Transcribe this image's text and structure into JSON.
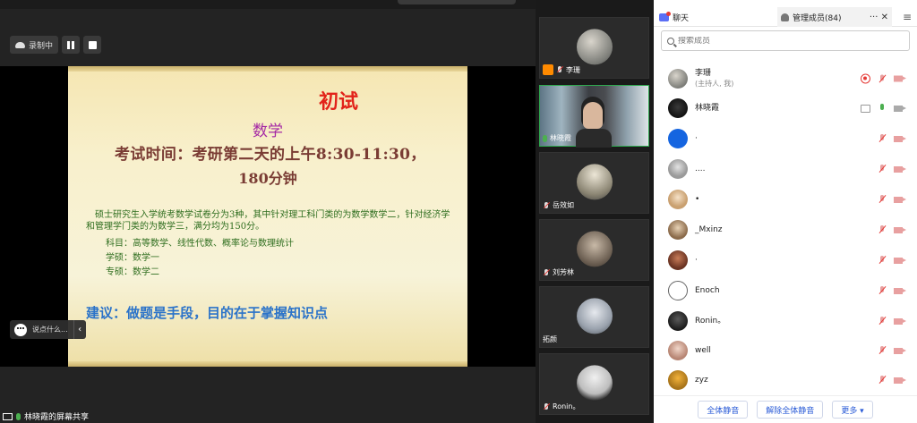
{
  "recording": {
    "status_label": "录制中"
  },
  "slide": {
    "title": "初试",
    "subject": "数学",
    "exam_time": "考试时间：考研第二天的上午8:30-11:30，",
    "duration": "180分钟",
    "paragraph": "硕士研究生入学统考数学试卷分为3种，其中针对理工科门类的为数学数学二，针对经济学和管理学门类的为数学三，满分均为150分。",
    "subjects_line": "科目：高等数学、线性代数、概率论与数理统计",
    "academic_line": "学硕：数学一",
    "professional_line": "专硕：数学二",
    "advice": "建议：做题是手段，目的在于掌握知识点"
  },
  "chat_input": {
    "placeholder": "说点什么..."
  },
  "share_bar": {
    "label": "林晓霞的屏幕共享"
  },
  "video_tiles": [
    {
      "name": "李珊"
    },
    {
      "name": "林晓霞"
    },
    {
      "name": "岳效如"
    },
    {
      "name": "刘芳林"
    },
    {
      "name": "拓颜"
    },
    {
      "name": "Ronin。"
    }
  ],
  "panel": {
    "chat_tab": "聊天",
    "members_tab": "管理成员(84)",
    "more": "···",
    "close": "✕",
    "menu": "≡",
    "search_placeholder": "搜索成员",
    "members": [
      {
        "name": "李珊",
        "role": "(主持人, 我)"
      },
      {
        "name": "林晓霞"
      },
      {
        "name": "·"
      },
      {
        "name": "...."
      },
      {
        "name": "•"
      },
      {
        "name": "_Mxinz"
      },
      {
        "name": "·"
      },
      {
        "name": "Enoch"
      },
      {
        "name": "Ronin。"
      },
      {
        "name": "well"
      },
      {
        "name": "zyz"
      }
    ],
    "mute_all": "全体静音",
    "unmute_all": "解除全体静音",
    "more_button": "更多 ▾"
  }
}
